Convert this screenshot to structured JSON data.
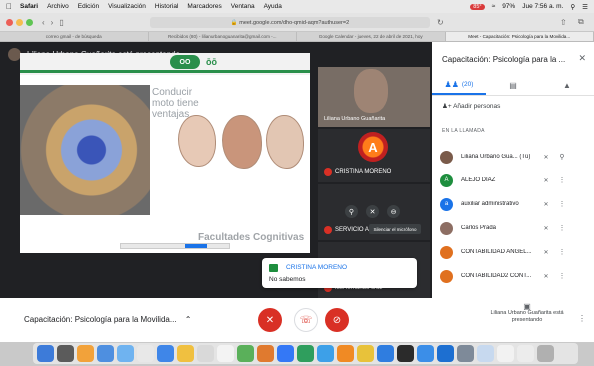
{
  "menubar": {
    "apple": "",
    "items": [
      "Safari",
      "Archivo",
      "Edición",
      "Visualización",
      "Historial",
      "Marcadores",
      "Ventana",
      "Ayuda"
    ],
    "battery": "97%",
    "clock": "Jue 7:56 a. m.",
    "badge": "85°"
  },
  "browser": {
    "address": "meet.google.com/dho-qmid-aqm?authuser=2",
    "tabs": [
      "correo gmail - de búsqueda",
      "Recibidos (80) - lilianurbanoguanarita@gmail.com -...",
      "Google Calendar - jueves, 22 de abril de 2021, hoy",
      "Meet - Capacitación: Psicología para la Movilida..."
    ]
  },
  "meet": {
    "presenting_text": "Liliana Urbano Guañarita está presentando",
    "slide": {
      "quote": "Conducir moto tiene ventajas",
      "heading": "Facultades Cognitivas",
      "logo": "OO",
      "logo_text": "ōō"
    },
    "self_tile_name": "Liliana Urbano Guañarita",
    "tiles": [
      {
        "name": "CRISTINA MORENO",
        "logo": "A"
      },
      {
        "name": "SERVICIO AL CLIENTE"
      },
      {
        "name": "luis fernando cruz"
      }
    ],
    "tooltip": "Silenciar el micrófono",
    "chat_popup": {
      "from": "CRISTINA MORENO",
      "message": "No sabemos"
    }
  },
  "panel": {
    "title": "Capacitación: Psicología para la ...",
    "tabs": [
      {
        "label": "(20)",
        "icon": "people-icon"
      },
      {
        "label": "",
        "icon": "chat-icon"
      },
      {
        "label": "",
        "icon": "activities-icon"
      }
    ],
    "add_people": "Añadir personas",
    "section": "EN LA LLAMADA",
    "people": [
      {
        "name": "Liliana Urbano Gua...",
        "suffix": "(Tú)",
        "initial": "",
        "color": "#7a5b4a"
      },
      {
        "name": "ALEJO DIAZ",
        "initial": "A",
        "color": "#1e8e3e"
      },
      {
        "name": "auxiliar administrativo",
        "initial": "a",
        "color": "#1a73e8"
      },
      {
        "name": "Carlos Prada",
        "initial": "",
        "color": "#8d6e63"
      },
      {
        "name": "CONTABILIDAD ANGEL...",
        "initial": "",
        "color": "#e0701f"
      },
      {
        "name": "CONTABILIDAD2 CONT...",
        "initial": "",
        "color": "#e0701f"
      }
    ]
  },
  "bottom": {
    "meeting_name": "Capacitación: Psicología para la Movilida...",
    "presenter": "Liliana Urbano Guañarita está presentando"
  },
  "dock": {
    "colors": [
      "#3d7bd9",
      "#5b5b5b",
      "#f2a23a",
      "#4e8fe0",
      "#6fb3f0",
      "#e8e8e8",
      "#3f86e8",
      "#f0c040",
      "#d9d9d9",
      "#f3f3f3",
      "#5ab05a",
      "#e07a2f",
      "#3478f6",
      "#2f9e5d",
      "#3da0e8",
      "#f08a24",
      "#e8c23a",
      "#2f7de0",
      "#2b2b2b",
      "#3b8ee8",
      "#1d6fd1",
      "#7e8a99",
      "#c7d9ef",
      "#f2f2f2",
      "#ececec",
      "#b0b0b0"
    ]
  }
}
